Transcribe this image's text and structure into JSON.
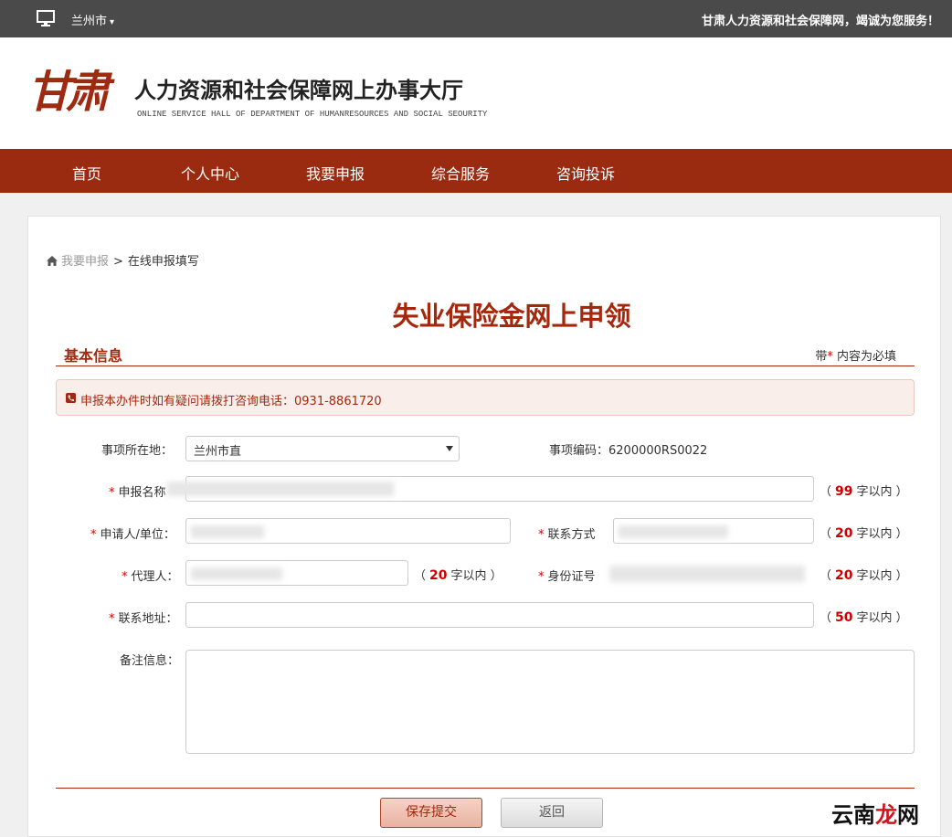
{
  "topbar": {
    "city": "兰州市",
    "welcome": "甘肃人力资源和社会保障网，竭诚为您服务！"
  },
  "header": {
    "logo_mark": "甘肃",
    "title": "人力资源和社会保障网上办事大厅",
    "subtitle": "ONLINE SERVICE HALL OF DEPARTMENT OF HUMANRESOURCES AND SOCIAL SEOURITY"
  },
  "nav": {
    "items": [
      "首页",
      "个人中心",
      "我要申报",
      "综合服务",
      "咨询投诉"
    ]
  },
  "breadcrumb": {
    "parent": "我要申报",
    "separator": ">",
    "current": "在线申报填写"
  },
  "page_title": "失业保险金网上申领",
  "section": {
    "name": "基本信息",
    "required_prefix": "带",
    "required_star": "*",
    "required_suffix": " 内容为必填"
  },
  "notice": "申报本办件时如有疑问请拨打咨询电话：0931-8861720",
  "form": {
    "location_label": "事项所在地：",
    "location_value": "兰州市直",
    "code_label": "事项编码：",
    "code_value": "6200000RS0022",
    "name_label": "申报名称",
    "name_limit": "99",
    "applicant_label": "申请人/单位：",
    "contact_label": "联系方式",
    "contact_limit": "20",
    "agent_label": "代理人：",
    "agent_limit": "20",
    "idcard_label": "身份证号",
    "idcard_limit": "20",
    "address_label": "联系地址：",
    "address_limit": "50",
    "remark_label": "备注信息：",
    "limit_open": "（",
    "limit_suffix": "字以内 ）"
  },
  "buttons": {
    "save": "保存提交",
    "back": "返回"
  },
  "watermark": {
    "black": "云南",
    "red": "龙",
    "black2": "网"
  },
  "colors": {
    "brand": "#9b2b10",
    "topbar": "#4a4a4a",
    "accent_red": "#cc0000"
  }
}
